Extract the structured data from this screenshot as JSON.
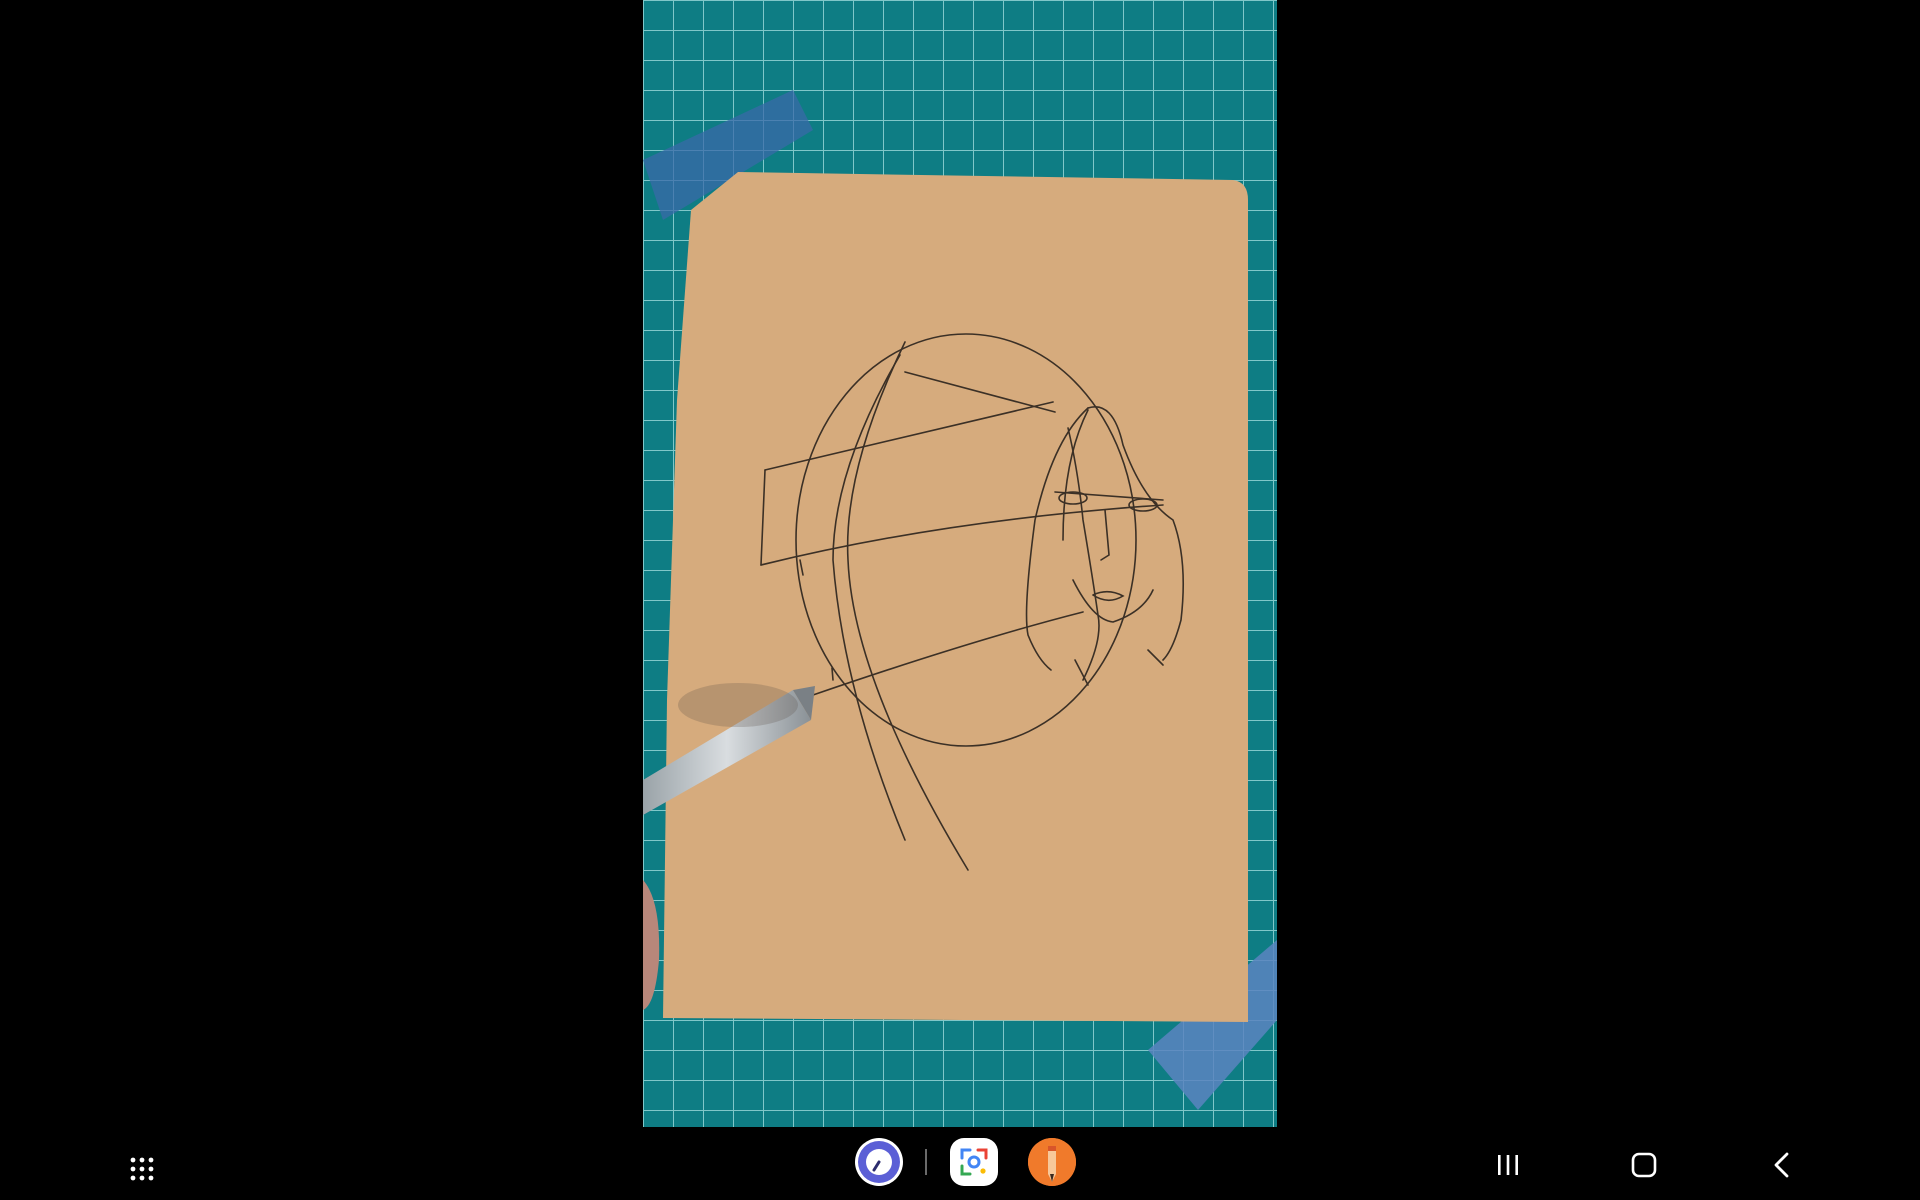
{
  "video": {
    "description_icon": "video-frame",
    "scene": "drawing-on-kraft-paper"
  },
  "navbar": {
    "apps_icon": "apps-grid-icon",
    "dock": [
      {
        "name": "clock-app",
        "icon": "clock-icon",
        "color": "#5b5fd6"
      },
      {
        "name": "lens-app",
        "icon": "lens-icon",
        "color": "#ffffff"
      },
      {
        "name": "sketch-app",
        "icon": "pencil-icon",
        "color": "#f07a2b"
      }
    ],
    "recents_icon": "recents-icon",
    "home_icon": "home-icon",
    "back_icon": "back-icon"
  },
  "colors": {
    "mat": "#0d7f86",
    "paper": "#d6ab7d",
    "background": "#000000"
  }
}
